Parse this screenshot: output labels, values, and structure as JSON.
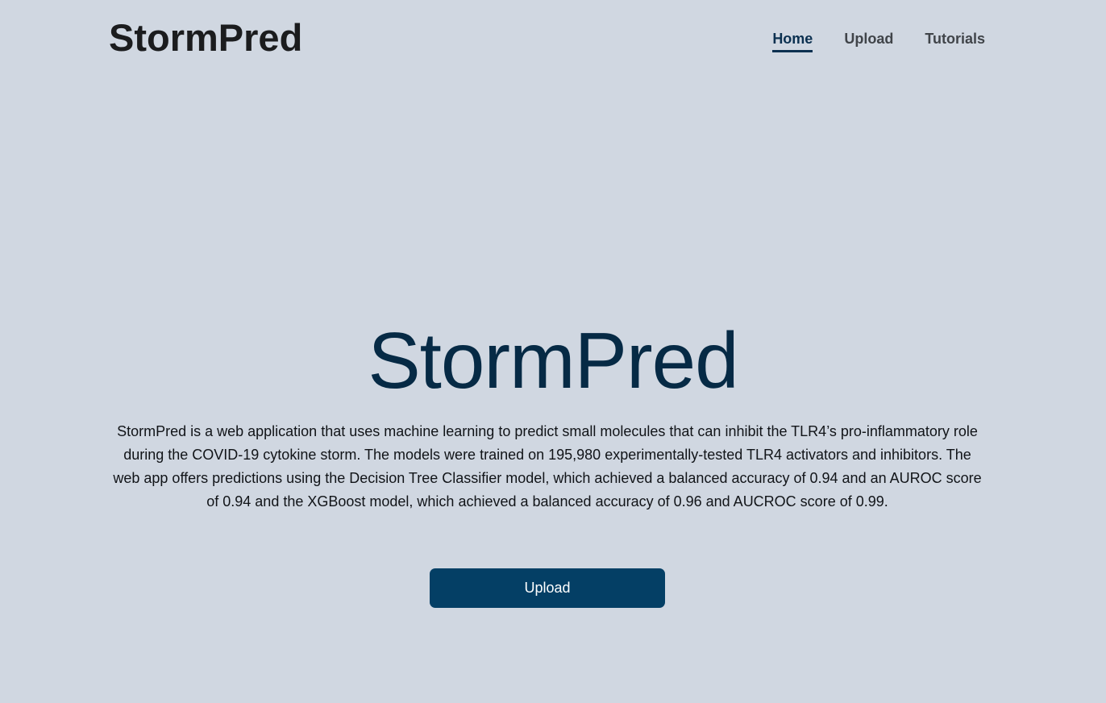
{
  "header": {
    "brand": "StormPred",
    "nav": [
      {
        "label": "Home",
        "active": true
      },
      {
        "label": "Upload",
        "active": false
      },
      {
        "label": "Tutorials",
        "active": false
      }
    ]
  },
  "hero": {
    "title": "StormPred",
    "description": "StormPred is a web application that uses machine learning to predict small molecules that can inhibit the TLR4’s pro-inflammatory role during the COVID-19 cytokine storm. The models were trained on 195,980 experimentally-tested TLR4 activators and inhibitors. The web app offers predictions using the Decision Tree Classifier model, which achieved a balanced accuracy of 0.94 and an AUROC score of 0.94 and the XGBoost model, which achieved a balanced accuracy of 0.96 and AUCROC score of 0.99.",
    "button_label": "Upload"
  },
  "colors": {
    "background": "#d0d7e1",
    "title": "#062a45",
    "button": "#043f65",
    "nav_active": "#0b3050"
  }
}
